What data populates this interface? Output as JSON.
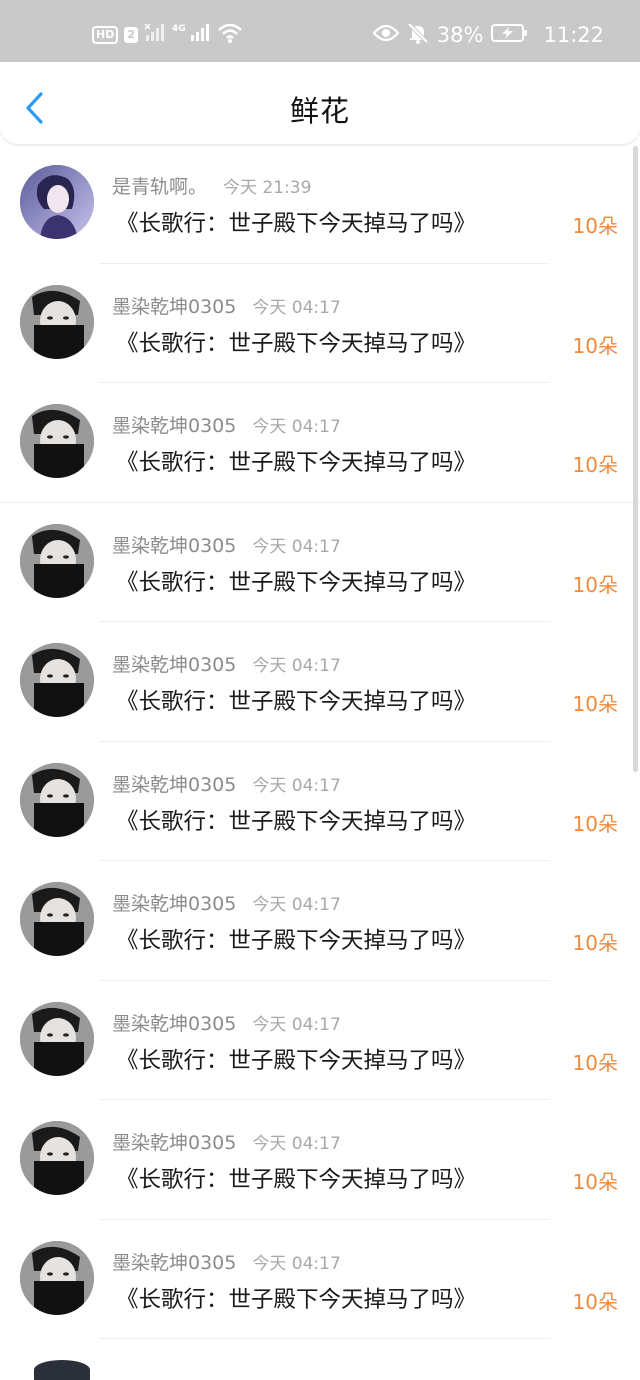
{
  "status_bar": {
    "left_badges": [
      "HD",
      "2"
    ],
    "network_label": "4G",
    "battery": "38%",
    "time": "11:22"
  },
  "header": {
    "title": "鲜花"
  },
  "list": {
    "items": [
      {
        "name": "是青轨啊。",
        "time": "今天 21:39",
        "book": "《长歌行：世子殿下今天掉马了吗》",
        "count": "10朵",
        "avatar": "girl-avatar"
      },
      {
        "name": "墨染乾坤0305",
        "time": "今天 04:17",
        "book": "《长歌行：世子殿下今天掉马了吗》",
        "count": "10朵",
        "avatar": "masked-man-avatar"
      },
      {
        "name": "墨染乾坤0305",
        "time": "今天 04:17",
        "book": "《长歌行：世子殿下今天掉马了吗》",
        "count": "10朵",
        "avatar": "masked-man-avatar"
      },
      {
        "name": "墨染乾坤0305",
        "time": "今天 04:17",
        "book": "《长歌行：世子殿下今天掉马了吗》",
        "count": "10朵",
        "avatar": "masked-man-avatar"
      },
      {
        "name": "墨染乾坤0305",
        "time": "今天 04:17",
        "book": "《长歌行：世子殿下今天掉马了吗》",
        "count": "10朵",
        "avatar": "masked-man-avatar"
      },
      {
        "name": "墨染乾坤0305",
        "time": "今天 04:17",
        "book": "《长歌行：世子殿下今天掉马了吗》",
        "count": "10朵",
        "avatar": "masked-man-avatar"
      },
      {
        "name": "墨染乾坤0305",
        "time": "今天 04:17",
        "book": "《长歌行：世子殿下今天掉马了吗》",
        "count": "10朵",
        "avatar": "masked-man-avatar"
      },
      {
        "name": "墨染乾坤0305",
        "time": "今天 04:17",
        "book": "《长歌行：世子殿下今天掉马了吗》",
        "count": "10朵",
        "avatar": "masked-man-avatar"
      },
      {
        "name": "墨染乾坤0305",
        "time": "今天 04:17",
        "book": "《长歌行：世子殿下今天掉马了吗》",
        "count": "10朵",
        "avatar": "masked-man-avatar"
      },
      {
        "name": "墨染乾坤0305",
        "time": "今天 04:17",
        "book": "《长歌行：世子殿下今天掉马了吗》",
        "count": "10朵",
        "avatar": "masked-man-avatar"
      }
    ]
  },
  "colors": {
    "accent_back": "#2b9af3",
    "count_orange": "#f08a3c",
    "status_bar_bg": "#c9c9c9"
  }
}
